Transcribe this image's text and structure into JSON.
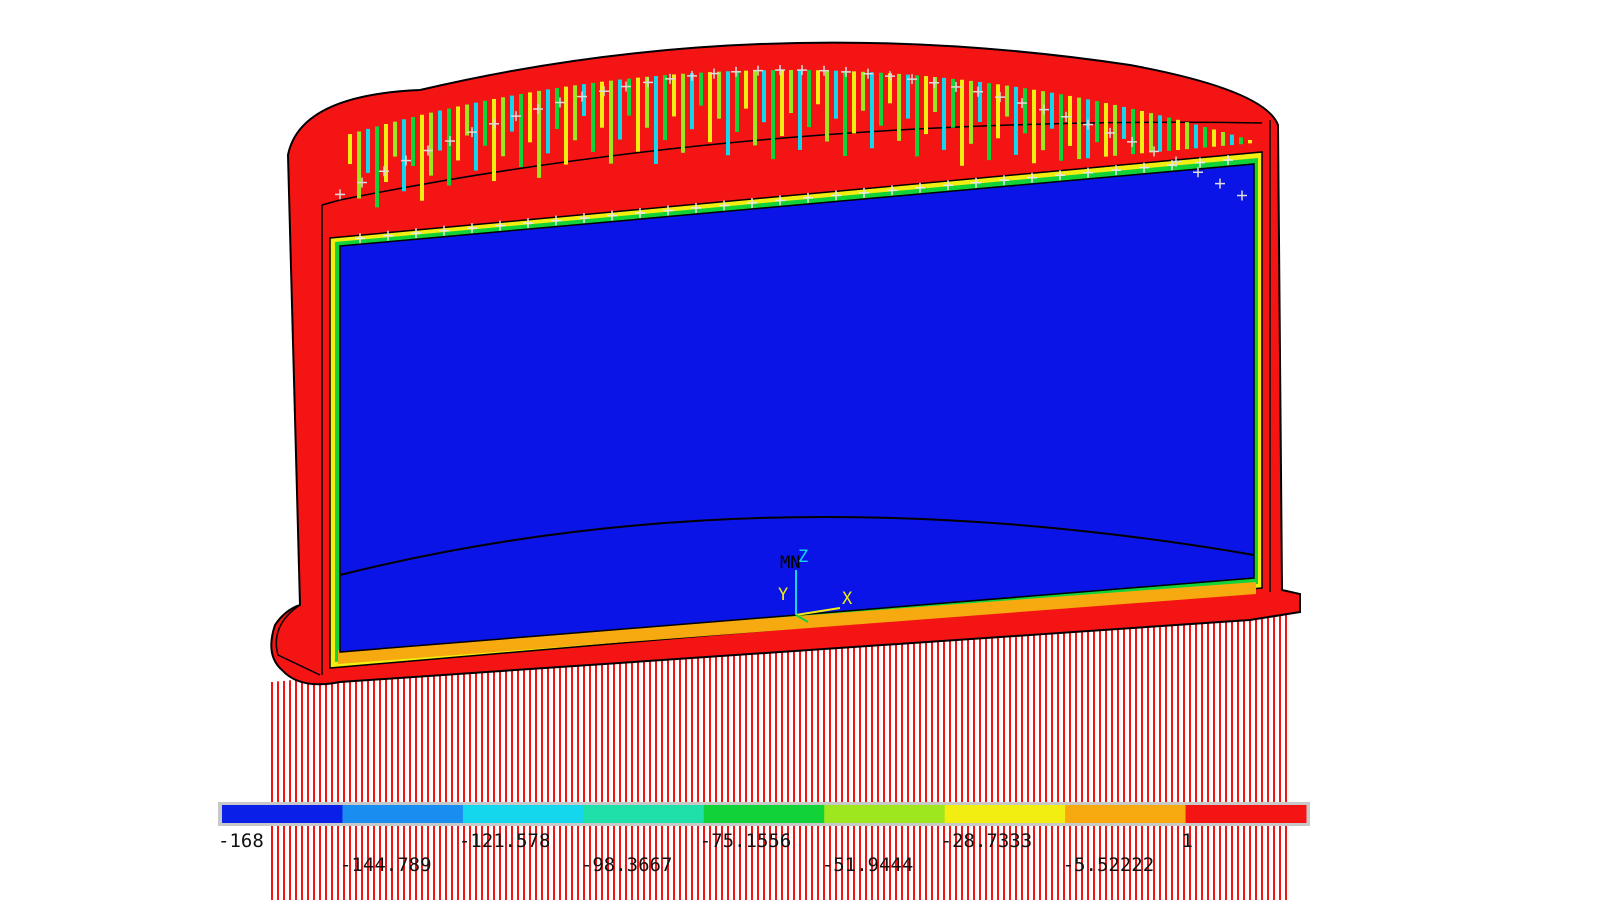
{
  "legend": {
    "colors": [
      "#0a1fe8",
      "#1a8df0",
      "#14d7ee",
      "#1ee0a8",
      "#12d23a",
      "#9ee61e",
      "#f2ee12",
      "#f6aa10",
      "#f51414"
    ],
    "row1": [
      "-168",
      "-121.578",
      "-75.1556",
      "-28.7333",
      "1"
    ],
    "row2": [
      "-144.789",
      "-98.3667",
      "-51.9444",
      "-5.52222"
    ]
  },
  "triad": {
    "z": "Z",
    "y": "Y",
    "x": "X",
    "m": "MN"
  },
  "palette": {
    "background": "#ffffff",
    "shell": "#f51414",
    "interior": "#0a14e6",
    "rim_orange": "#f6aa10",
    "rim_green": "#12d23a",
    "rim_yellow": "#f2ee12"
  }
}
